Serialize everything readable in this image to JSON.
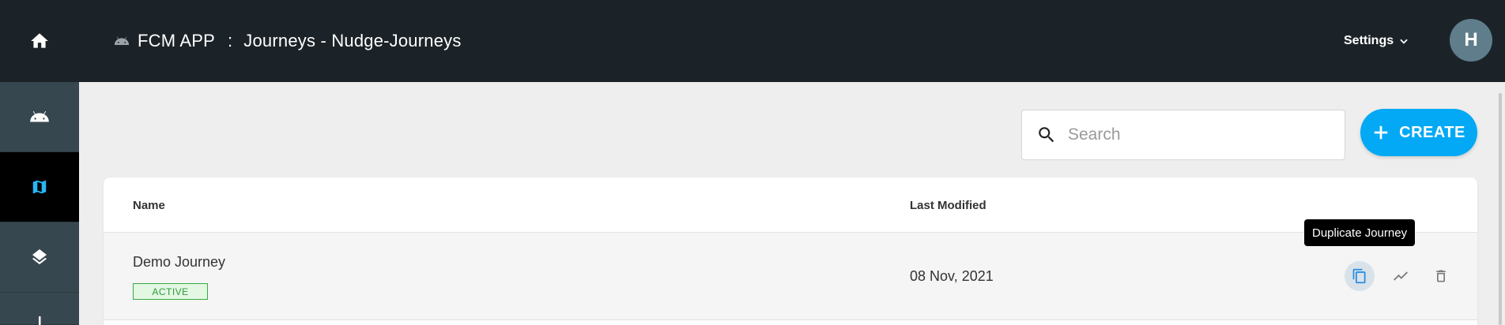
{
  "header": {
    "app_name": "FCM APP",
    "separator": ":",
    "page_title": "Journeys - Nudge-Journeys",
    "settings_label": "Settings",
    "avatar_initial": "H"
  },
  "sidebar": {
    "items": [
      {
        "icon": "android-icon",
        "active": false
      },
      {
        "icon": "map-icon",
        "active": true
      },
      {
        "icon": "layers-icon",
        "active": false
      },
      {
        "icon": "more-icon",
        "active": false
      }
    ]
  },
  "search": {
    "placeholder": "Search",
    "value": ""
  },
  "create_button": {
    "label": "CREATE"
  },
  "table": {
    "columns": [
      "Name",
      "Last Modified"
    ],
    "rows": [
      {
        "name": "Demo Journey",
        "status": "ACTIVE",
        "last_modified": "08 Nov, 2021"
      }
    ]
  },
  "tooltip": {
    "text": "Duplicate Journey"
  },
  "colors": {
    "topbar": "#1c2328",
    "sidebar": "#37474f",
    "accent": "#03a9f4",
    "active_badge": "#3aa845",
    "avatar": "#607d8b"
  }
}
